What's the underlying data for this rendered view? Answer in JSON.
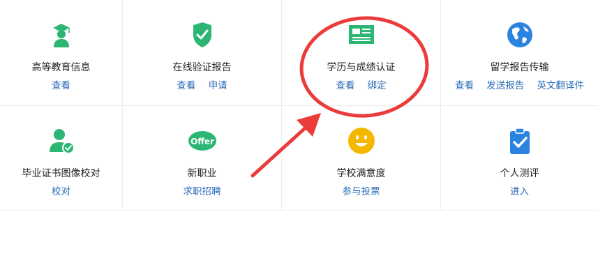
{
  "colors": {
    "green": "#2bb673",
    "blue": "#2b83e0",
    "yellow": "#f5b800",
    "link": "#2b6cb8",
    "annotation_red": "#ec3b3b"
  },
  "rows": [
    [
      {
        "icon": "graduate-icon",
        "title": "高等教育信息",
        "links": [
          "查看"
        ]
      },
      {
        "icon": "shield-check-icon",
        "title": "在线验证报告",
        "links": [
          "查看",
          "申请"
        ]
      },
      {
        "icon": "id-card-icon",
        "title": "学历与成绩认证",
        "links": [
          "查看",
          "绑定"
        ]
      },
      {
        "icon": "globe-icon",
        "title": "留学报告传输",
        "links": [
          "查看",
          "发送报告",
          "英文翻译件"
        ]
      }
    ],
    [
      {
        "icon": "user-check-icon",
        "title": "毕业证书图像校对",
        "links": [
          "校对"
        ]
      },
      {
        "icon": "offer-badge-icon",
        "title": "新职业",
        "links": [
          "求职招聘"
        ],
        "badge_text": "Offer"
      },
      {
        "icon": "smiley-icon",
        "title": "学校满意度",
        "links": [
          "参与投票"
        ]
      },
      {
        "icon": "clipboard-check-icon",
        "title": "个人测评",
        "links": [
          "进入"
        ]
      }
    ]
  ],
  "annotation": {
    "type": "red-circle-with-arrow",
    "target": "学历与成绩认证"
  }
}
